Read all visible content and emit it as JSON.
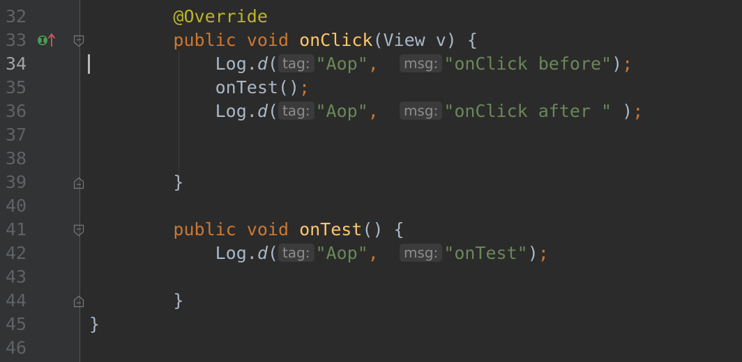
{
  "editor": {
    "current_line": "34",
    "lines": [
      {
        "number": "32"
      },
      {
        "number": "33"
      },
      {
        "number": "34"
      },
      {
        "number": "35"
      },
      {
        "number": "36"
      },
      {
        "number": "37"
      },
      {
        "number": "38"
      },
      {
        "number": "39"
      },
      {
        "number": "40"
      },
      {
        "number": "41"
      },
      {
        "number": "42"
      },
      {
        "number": "43"
      },
      {
        "number": "44"
      },
      {
        "number": "45"
      },
      {
        "number": "46"
      }
    ],
    "tokens": {
      "annotation": "@Override",
      "kw_public": "public",
      "kw_void": "void",
      "method_onClick": "onClick",
      "params_onClick": "(View v) {",
      "log": "Log.",
      "d": "d",
      "paren_open": "(",
      "hint_tag": "tag:",
      "hint_msg": "msg:",
      "str_aop": "\"Aop\"",
      "comma": ",",
      "str_before": "\"onClick before\"",
      "str_after": "\"onClick after \"",
      "str_onTest": "\"onTest\"",
      "close_paren": ")",
      "close_paren_spaced": " )",
      "semicolon": ";",
      "call_onTest": "onTest()",
      "close_brace": "}",
      "method_onTest": "onTest",
      "params_onTest": "() {"
    }
  },
  "colors": {
    "background": "#2b2b2b",
    "gutter": "#313335",
    "keyword": "#cc7832",
    "method": "#ffc66d",
    "annotation": "#bbb529",
    "string": "#6a8759",
    "text": "#a9b7c6",
    "line_number": "#606366"
  },
  "icons": {
    "line33": "implementation-marker-icon",
    "fold": "fold-marker-icon"
  }
}
